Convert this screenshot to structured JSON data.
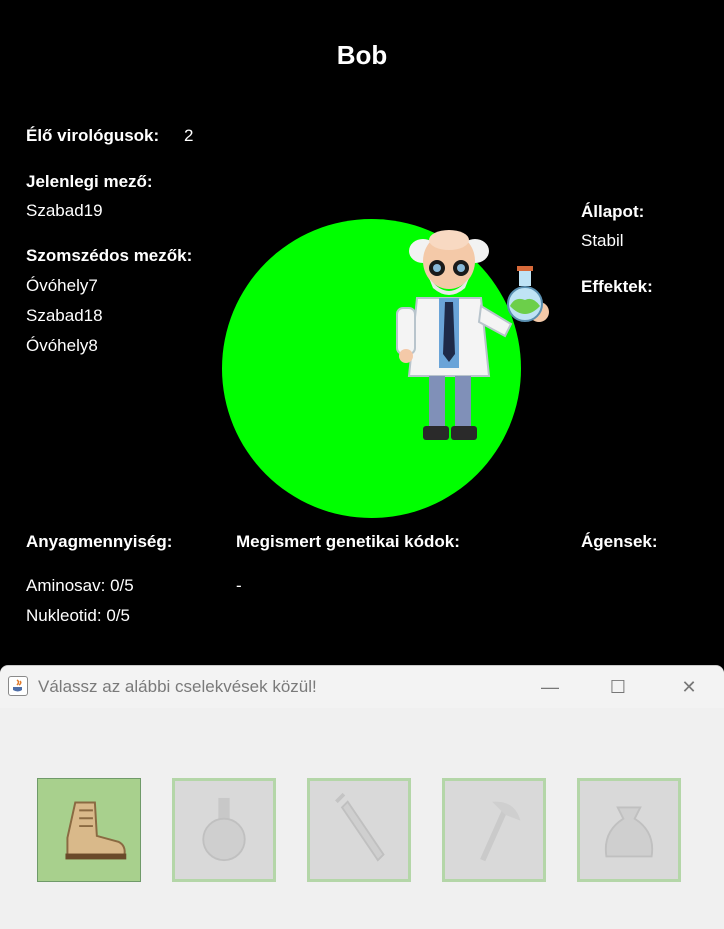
{
  "header": {
    "title": "Bob"
  },
  "stats": {
    "alive_label": "Élő virológusok:",
    "alive_count": "2",
    "current_field_label": "Jelenlegi mező:",
    "current_field": "Szabad19",
    "neighbors_label": "Szomszédos mezők:",
    "neighbors": [
      "Óvóhely7",
      "Szabad18",
      "Óvóhely8"
    ],
    "state_label": "Állapot:",
    "state": "Stabil",
    "effects_label": "Effektek:"
  },
  "bottom": {
    "materials_label": "Anyagmennyiség:",
    "materials": [
      "Aminosav: 0/5",
      "Nukleotid: 0/5"
    ],
    "codes_label": "Megismert genetikai kódok:",
    "codes_value": "-",
    "agents_label": "Ágensek:"
  },
  "dialog": {
    "title": "Válassz az alábbi cselekvések közül!",
    "controls": {
      "minimize": "—",
      "maximize": "☐",
      "close": "✕"
    },
    "actions": [
      {
        "icon": "boot-icon",
        "enabled": true
      },
      {
        "icon": "flask-icon",
        "enabled": false
      },
      {
        "icon": "syringe-icon",
        "enabled": false
      },
      {
        "icon": "axe-icon",
        "enabled": false
      },
      {
        "icon": "bag-icon",
        "enabled": false
      }
    ]
  },
  "colors": {
    "background": "#000000",
    "field_circle": "#00ff00",
    "active_button": "#a8d08d"
  }
}
